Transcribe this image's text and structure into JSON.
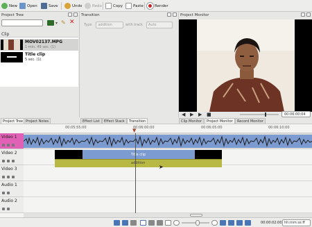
{
  "toolbar": {
    "new": "New",
    "open": "Open",
    "save": "Save",
    "undo": "Undo",
    "redo": "Redo",
    "copy": "Copy",
    "paste": "Paste",
    "render": "Render"
  },
  "project_tree": {
    "title": "Project Tree",
    "column_clip": "Clip",
    "clips": [
      {
        "name": "MOV02137.MPG",
        "meta": "1 min. 49 sec. (1)"
      },
      {
        "name": "Title clip",
        "meta": "5 sec. (1)"
      }
    ]
  },
  "transition": {
    "title": "Transition",
    "type_label": "Type",
    "type_value": "addition",
    "with_track_label": "with track",
    "with_track_value": "Auto"
  },
  "monitor": {
    "title": "Project Monitor",
    "timecode": "00:06:00:04"
  },
  "tabs": {
    "project_tree": "Project Tree",
    "project_notes": "Project Notes",
    "effect_list": "Effect List",
    "effect_stack": "Effect Stack",
    "transition": "Transition",
    "clip_monitor": "Clip Monitor",
    "project_monitor": "Project Monitor",
    "record_monitor": "Record Monitor"
  },
  "timeline": {
    "ruler_labels": [
      "00:05:55:00",
      "00:06:00:00",
      "00:06:05:00",
      "00:06:10:00"
    ],
    "tracks": [
      {
        "name": "Video 1"
      },
      {
        "name": "Video 2"
      },
      {
        "name": "Video 3"
      },
      {
        "name": "Audio 1"
      },
      {
        "name": "Audio 2"
      }
    ],
    "title_clip_label": "Title clip",
    "transition_label": "addition"
  },
  "status": {
    "position": "00:00:02:00",
    "timecode_format": "hh:mm:ss:ff"
  }
}
